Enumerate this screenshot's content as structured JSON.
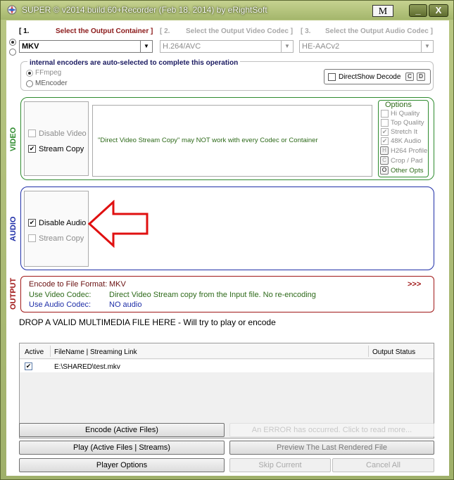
{
  "window": {
    "title": "SUPER © v2014.build.60+Recorder (Feb 18, 2014) by eRightSoft",
    "m_button": "M",
    "minimize": "_",
    "maximize": "□",
    "close": "X"
  },
  "steps": {
    "s1_num": "[ 1.",
    "s1_label": "Select the Output Container ]",
    "s2_num": "[ 2.",
    "s2_label": "Select the Output Video Codec ]",
    "s3_num": "[ 3.",
    "s3_label": "Select the Output Audio Codec ]"
  },
  "combos": {
    "container": "MKV",
    "video_codec": "H.264/AVC",
    "audio_codec": "HE-AACv2",
    "arrow": "▼"
  },
  "encoders": {
    "title": "internal encoders are auto-selected to complete this operation",
    "ffmpeg": "FFmpeg",
    "mencoder": "MEncoder",
    "directshow": "DirectShow Decode",
    "c_button": "C",
    "d_button": "D"
  },
  "video": {
    "section_label": "VIDEO",
    "disable_video": "Disable Video",
    "stream_copy": "Stream Copy",
    "stream_copy_checked": true,
    "message": "\"Direct Video Stream Copy\" may NOT work with every Codec or Container"
  },
  "options": {
    "title": "Options",
    "hi_quality": "Hi Quality",
    "top_quality": "Top Quality",
    "stretch_it": "Stretch It",
    "audio_48k": "48K Audio",
    "h264_profile": "H264 Profile",
    "crop_pad": "Crop / Pad",
    "other_opts": "Other Opts",
    "h_icon": "H",
    "c_icon": "C",
    "o_icon": "O",
    "check": "✔"
  },
  "audio": {
    "section_label": "AUDIO",
    "disable_audio": "Disable Audio",
    "stream_copy": "Stream Copy"
  },
  "output": {
    "section_label": "OUTPUT",
    "format_label": "Encode to File Format:",
    "format_value": "MKV",
    "video_label": "Use Video Codec:",
    "video_value": "Direct Video Stream copy from the Input file.  No re-encoding",
    "audio_label": "Use Audio Codec:",
    "audio_value": "NO audio",
    "more": ">>>"
  },
  "drop_hint": "DROP A VALID MULTIMEDIA FILE HERE - Will try to play or encode",
  "files": {
    "col_active": "Active",
    "col_filename": "FileName  |  Streaming Link",
    "col_status": "Output Status",
    "rows": [
      {
        "active": true,
        "filename": "E:\\SHARED\\test.mkv",
        "status": ""
      }
    ]
  },
  "buttons": {
    "encode": "Encode (Active Files)",
    "error": "An ERROR has occurred. Click to read more...",
    "play": "Play (Active Files | Streams)",
    "preview": "Preview The Last Rendered File",
    "player_options": "Player Options",
    "skip": "Skip Current",
    "cancel": "Cancel All"
  },
  "colors": {
    "step_red": "#8b1a1a",
    "video_green": "#2e8b2e",
    "audio_blue": "#1f2fa8",
    "output_red": "#a01818",
    "arrow_red": "#e01010"
  }
}
